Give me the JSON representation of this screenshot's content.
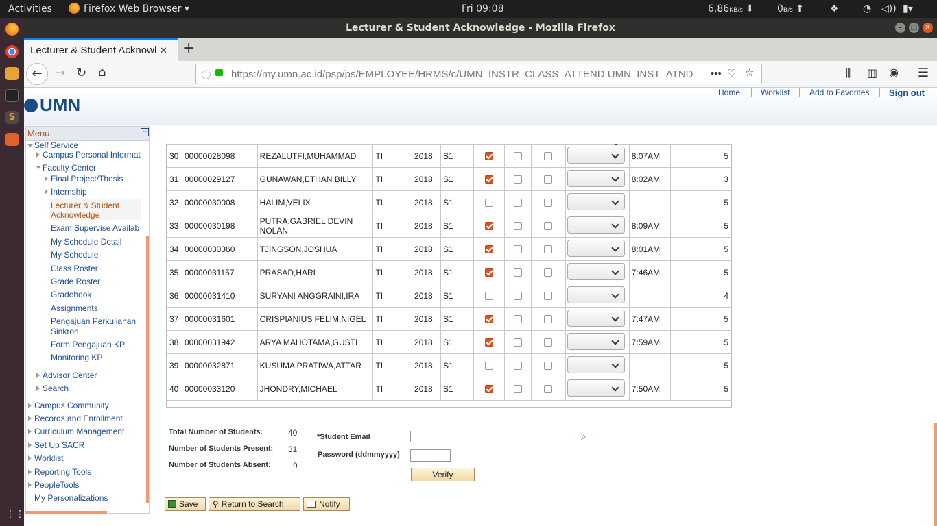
{
  "topbar": {
    "activities": "Activities",
    "app": "Firefox Web Browser ▾",
    "clock": "Fri 09:08",
    "down_speed": "6.86",
    "down_unit": "KB/s",
    "up_speed": "0",
    "up_unit": "B/s"
  },
  "window": {
    "title": "Lecturer & Student Acknowledge - Mozilla Firefox"
  },
  "tab": {
    "label": "Lecturer & Student Acknowl",
    "close": "✕",
    "new": "+"
  },
  "url": {
    "text": "https://my.umn.ac.id/psp/ps/EMPLOYEE/HRMS/c/UMN_INSTR_CLASS_ATTEND.UMN_INST_ATND_",
    "more": "•••"
  },
  "header": {
    "logo": "UMN",
    "links": [
      "Home",
      "Worklist",
      "Add to Favorites",
      "Sign out"
    ]
  },
  "menu": {
    "title": "Menu",
    "items": [
      "Self Service",
      "Campus Personal Informat",
      "Faculty Center",
      "Final Project/Thesis",
      "Internship",
      "Lecturer & Student",
      "Acknowledge",
      "Exam Supervise Availab",
      "My Schedule Detail",
      "My Schedule",
      "Class Roster",
      "Grade Roster",
      "Gradebook",
      "Assignments",
      "Pengajuan Perkuliahan",
      "Sinkron",
      "Form Pengajuan KP",
      "Monitoring KP",
      "Advisor Center",
      "Search",
      "Campus Community",
      "Records and Enrollment",
      "Curriculum Management",
      "Set Up SACR",
      "Worklist",
      "Reporting Tools",
      "PeopleTools",
      "My Personalizations"
    ]
  },
  "grid": {
    "rows": [
      {
        "no": "30",
        "id": "00000028098",
        "name": "REZALUTFI,MUHAMMAD",
        "prog": "TI",
        "year": "2018",
        "level": "S1",
        "present": true,
        "time": "8:07AM",
        "val": "5"
      },
      {
        "no": "31",
        "id": "00000029127",
        "name": "GUNAWAN,ETHAN BILLY",
        "prog": "TI",
        "year": "2018",
        "level": "S1",
        "present": true,
        "time": "8:02AM",
        "val": "3"
      },
      {
        "no": "32",
        "id": "00000030008",
        "name": "HALIM,VELIX",
        "prog": "TI",
        "year": "2018",
        "level": "S1",
        "present": false,
        "time": "",
        "val": "5"
      },
      {
        "no": "33",
        "id": "00000030198",
        "name": "PUTRA,GABRIEL DEVIN NOLAN",
        "prog": "TI",
        "year": "2018",
        "level": "S1",
        "present": true,
        "time": "8:09AM",
        "val": "5"
      },
      {
        "no": "34",
        "id": "00000030360",
        "name": "TJINGSON,JOSHUA",
        "prog": "TI",
        "year": "2018",
        "level": "S1",
        "present": true,
        "time": "8:01AM",
        "val": "5"
      },
      {
        "no": "35",
        "id": "00000031157",
        "name": "PRASAD,HARI",
        "prog": "TI",
        "year": "2018",
        "level": "S1",
        "present": true,
        "time": "7:46AM",
        "val": "5"
      },
      {
        "no": "36",
        "id": "00000031410",
        "name": "SURYANI ANGGRAINI,IRA",
        "prog": "TI",
        "year": "2018",
        "level": "S1",
        "present": false,
        "time": "",
        "val": "4"
      },
      {
        "no": "37",
        "id": "00000031601",
        "name": "CRISPIANIUS FELIM,NIGEL",
        "prog": "TI",
        "year": "2018",
        "level": "S1",
        "present": true,
        "time": "7:47AM",
        "val": "5"
      },
      {
        "no": "38",
        "id": "00000031942",
        "name": "ARYA MAHOTAMA,GUSTI",
        "prog": "TI",
        "year": "2018",
        "level": "S1",
        "present": true,
        "time": "7:59AM",
        "val": "5"
      },
      {
        "no": "39",
        "id": "00000032871",
        "name": "KUSUMA PRATIWA,ATTAR",
        "prog": "TI",
        "year": "2018",
        "level": "S1",
        "present": false,
        "time": "",
        "val": "5"
      },
      {
        "no": "40",
        "id": "00000033120",
        "name": "JHONDRY,MICHAEL",
        "prog": "TI",
        "year": "2018",
        "level": "S1",
        "present": true,
        "time": "7:50AM",
        "val": "5"
      }
    ]
  },
  "summary": {
    "total_label": "Total Number of Students:",
    "total": "40",
    "present_label": "Number of Students Present:",
    "present": "31",
    "absent_label": "Number of Students Absent:",
    "absent": "9"
  },
  "verify": {
    "email_label": "*Student Email",
    "email_value": "",
    "password_label": "Password (ddmmyyyy)",
    "password_value": "",
    "verify_label": "Verify"
  },
  "actions": {
    "save": "Save",
    "return": "Return to Search",
    "notify": "Notify"
  }
}
